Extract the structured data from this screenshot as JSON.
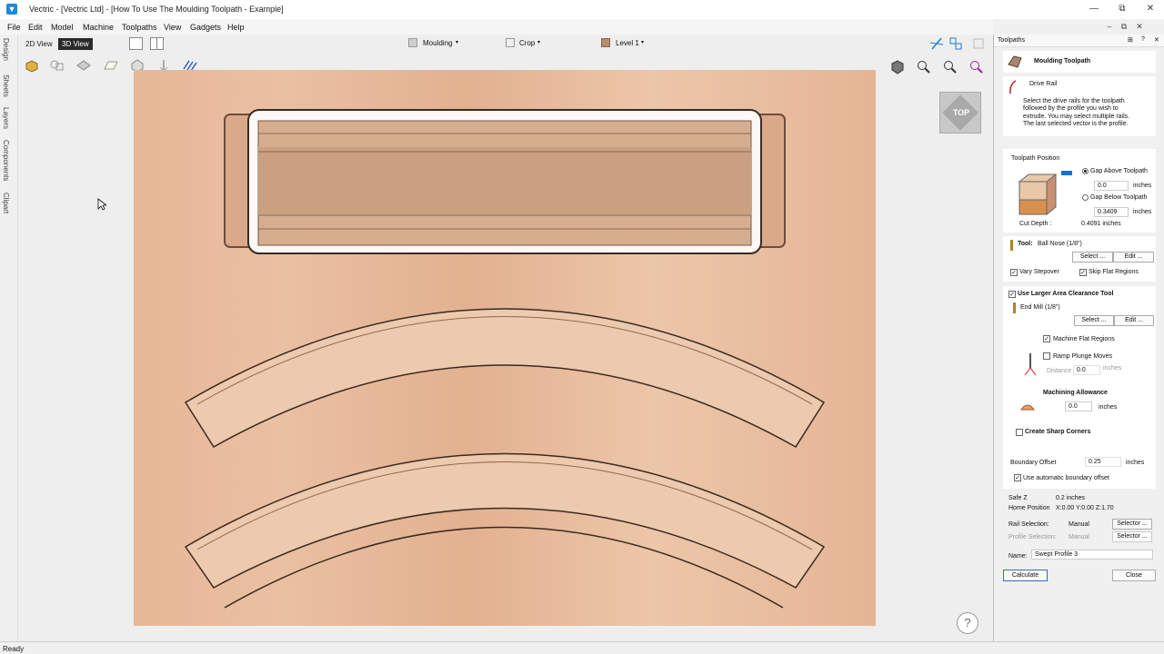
{
  "window": {
    "app_icon": "vectric-logo-icon",
    "title": "Vectric - [Vectric Ltd] - [How To Use The Moulding Toolpath - Example]",
    "minimize": "—",
    "maximize": "⧉",
    "close": "✕"
  },
  "menu": [
    "File",
    "Edit",
    "Model",
    "Machine",
    "Toolpaths",
    "View",
    "Gadgets",
    "Help"
  ],
  "left_tabs": [
    "Design",
    "Sheets",
    "Layers",
    "Components",
    "Clipart"
  ],
  "viewport": {
    "btn_2d": "2D View",
    "btn_3d": "3D View",
    "moulding_dropdown": "Moulding",
    "crop_dropdown": "Crop",
    "level_dropdown": "Level 1",
    "top_label": "TOP",
    "help": "?"
  },
  "status": "Ready",
  "panel": {
    "title": "Toolpaths",
    "header_title": "Moulding Toolpath",
    "drive_rail_label": "Drive Rail",
    "drive_rail_desc": [
      "Select the drive rails for the toolpath",
      "followed by the profile you wish to",
      "extrude. You may select multiple rails.",
      "The last selected vector is the profile."
    ],
    "toolpath_position_title": "Toolpath Position",
    "gap_above_label": "Gap Above Toolpath",
    "gap_above_value": "0.0",
    "gap_below_label": "Gap Below Toolpath",
    "gap_below_value": "0.3409",
    "units": "inches",
    "cut_depth_label": "Cut Depth :",
    "cut_depth_value": "0.4091 inches",
    "tool_label": "Tool:",
    "tool_value": "Ball Nose (1/8\")",
    "select_btn": "Select ...",
    "edit_btn": "Edit ...",
    "vary_stepover": "Vary Stepover",
    "skip_flat": "Skip Flat Regions",
    "larger_clearance": "Use Larger Area Clearance Tool",
    "clearance_tool": "End Mill (1/8\")",
    "machine_flat": "Machine Flat Regions",
    "ramp_plunge": "Ramp Plunge Moves",
    "distance_label": "Distance",
    "distance_value": "0.0",
    "machining_allowance_title": "Machining Allowance",
    "allowance_value": "0.0",
    "create_sharp": "Create Sharp Corners",
    "boundary_offset_label": "Boundary Offset",
    "boundary_offset_value": "0.25",
    "use_auto_boundary": "Use automatic boundary offset",
    "safe_z_label": "Safe Z",
    "safe_z_value": "0.2 inches",
    "home_label": "Home Position",
    "home_value": "X:0.00 Y:0.00 Z:1.70",
    "rail_selection_label": "Rail Selection:",
    "rail_selection_value": "Manual",
    "profile_selection_label": "Profile Selection:",
    "profile_selection_value": "Manual",
    "selector_btn": "Selector ...",
    "name_label": "Name:",
    "name_value": "Swept Profile 3",
    "calculate_btn": "Calculate",
    "close_btn": "Close"
  }
}
